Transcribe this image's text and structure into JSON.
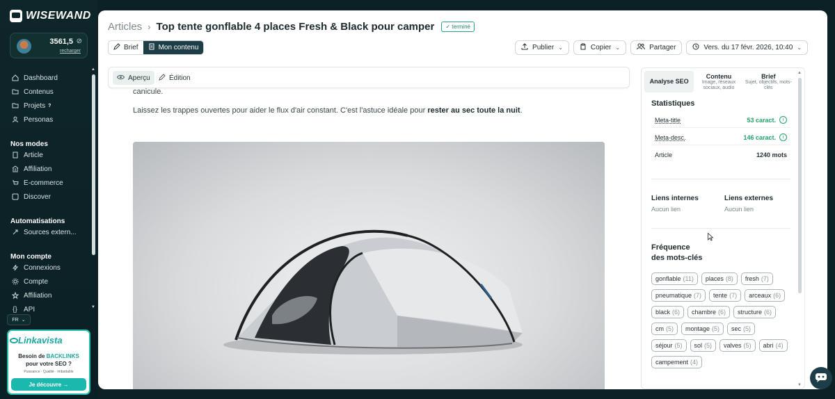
{
  "brand": {
    "name": "WISEWAND"
  },
  "account": {
    "credits": "3561,5",
    "recharge_label": "recharger"
  },
  "nav": {
    "main": [
      {
        "label": "Dashboard",
        "icon": "home-icon"
      },
      {
        "label": "Contenus",
        "icon": "folder-icon"
      },
      {
        "label": "Projets",
        "icon": "folder-icon",
        "badge": "?"
      },
      {
        "label": "Personas",
        "icon": "user-icon"
      }
    ],
    "modes_title": "Nos modes",
    "modes": [
      {
        "label": "Article",
        "icon": "document-icon"
      },
      {
        "label": "Affiliation",
        "icon": "bank-icon"
      },
      {
        "label": "E-commerce",
        "icon": "cart-icon"
      },
      {
        "label": "Discover",
        "icon": "compass-icon"
      }
    ],
    "auto_title": "Automatisations",
    "auto": [
      {
        "label": "Sources extern...",
        "icon": "link-icon"
      }
    ],
    "account_title": "Mon compte",
    "account": [
      {
        "label": "Connexions",
        "icon": "lightning-icon"
      },
      {
        "label": "Compte",
        "icon": "gear-icon"
      },
      {
        "label": "Affiliation",
        "icon": "star-icon"
      },
      {
        "label": "API",
        "icon": "code-icon"
      }
    ]
  },
  "language": "FR",
  "promo": {
    "brand": "Linkavista",
    "line1_pre": "Besoin de ",
    "line1_hl": "BACKLINKS",
    "line2": "pour votre SEO ?",
    "sub": "Puissance · Qualité · Imbattable",
    "cta": "Je découvre →"
  },
  "breadcrumb": {
    "root": "Articles",
    "title": "Top tente gonflable 4 places Fresh & Black pour camper",
    "status": "✓ terminé"
  },
  "tabs": {
    "brief": "Brief",
    "content": "Mon contenu"
  },
  "toolbar": {
    "publish": "Publier",
    "copy": "Copier",
    "share": "Partager",
    "version": "Vers. du 17 févr. 2026, 10:40"
  },
  "view": {
    "preview": "Aperçu",
    "edit": "Édition"
  },
  "article": {
    "line_top": "canicule.",
    "p1_pre": "Laissez les trappes ouvertes pour aider le flux d'air constant. C'est l'astuce idéale pour ",
    "p1_bold": "rester au sec toute la nuit",
    "p1_post": "."
  },
  "seo": {
    "tabs": [
      {
        "title": "Analyse SEO",
        "sub": ""
      },
      {
        "title": "Contenu",
        "sub": "Image, réseaux sociaux, audio"
      },
      {
        "title": "Brief",
        "sub": "Sujet, objectifs, mots-clés"
      }
    ],
    "stats_title": "Statistiques",
    "stats": [
      {
        "label": "Meta-title",
        "value": "53 caract."
      },
      {
        "label": "Meta-desc.",
        "value": "146 caract."
      },
      {
        "label": "Article",
        "value": "1240 mots"
      }
    ],
    "internal_title": "Liens internes",
    "internal_value": "Aucun lien",
    "external_title": "Liens externes",
    "external_value": "Aucun lien",
    "kw_title_1": "Fréquence",
    "kw_title_2": "des mots-clés",
    "keywords": [
      {
        "word": "gonflable",
        "count": "(11)"
      },
      {
        "word": "places",
        "count": "(8)"
      },
      {
        "word": "fresh",
        "count": "(7)"
      },
      {
        "word": "pneumatique",
        "count": "(7)"
      },
      {
        "word": "tente",
        "count": "(7)"
      },
      {
        "word": "arceaux",
        "count": "(6)"
      },
      {
        "word": "black",
        "count": "(6)"
      },
      {
        "word": "chambre",
        "count": "(6)"
      },
      {
        "word": "structure",
        "count": "(6)"
      },
      {
        "word": "cm",
        "count": "(5)"
      },
      {
        "word": "montage",
        "count": "(5)"
      },
      {
        "word": "sec",
        "count": "(5)"
      },
      {
        "word": "séjour",
        "count": "(5)"
      },
      {
        "word": "sol",
        "count": "(5)"
      },
      {
        "word": "valves",
        "count": "(5)"
      },
      {
        "word": "abri",
        "count": "(4)"
      },
      {
        "word": "campement",
        "count": "(4)"
      }
    ]
  },
  "colors": {
    "accent": "#1d3e47",
    "teal": "#1bb8ad",
    "green": "#23a36a",
    "sidebar_bg": "#0e2529"
  }
}
